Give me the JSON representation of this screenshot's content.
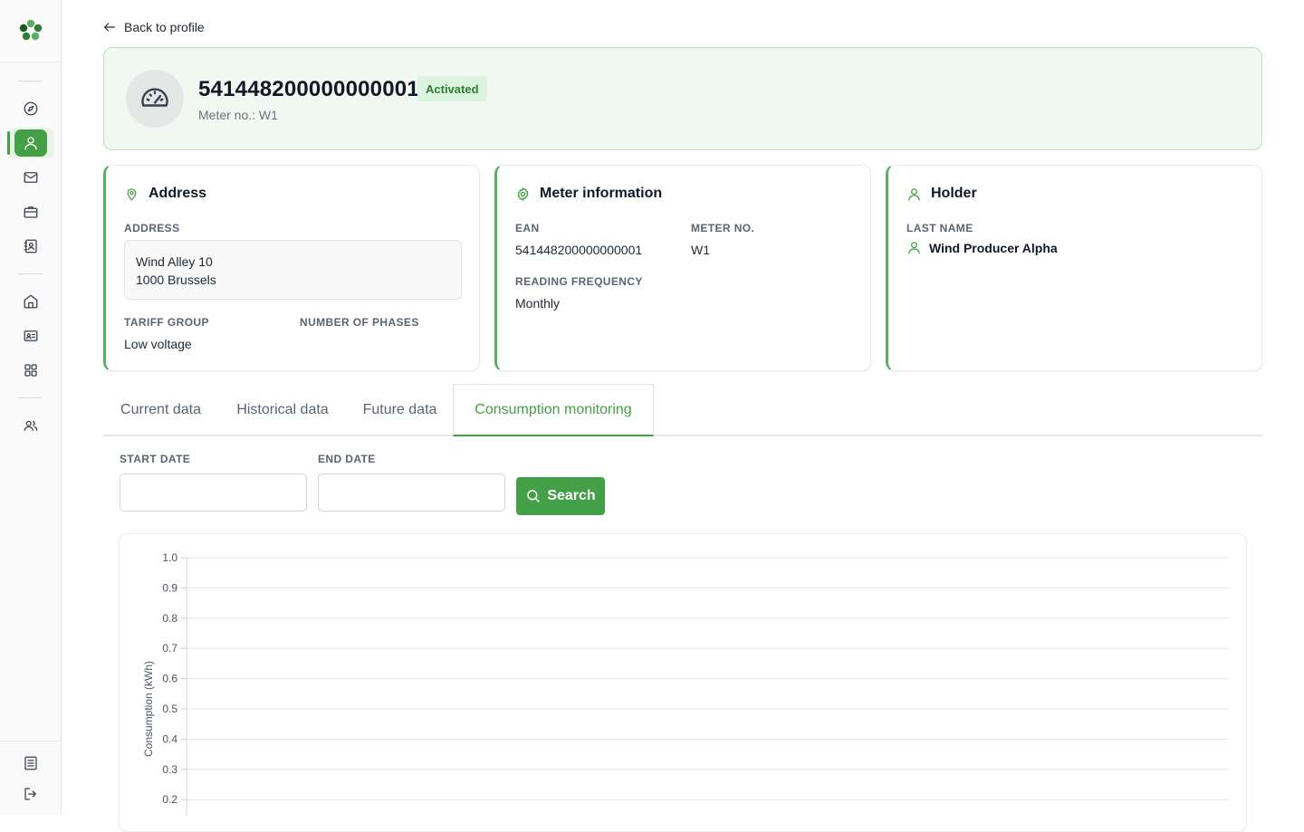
{
  "back_label": "Back to profile",
  "meter": {
    "ean": "541448200000000001",
    "status": "Activated",
    "subtitle": "Meter no.: W1"
  },
  "address_card": {
    "title": "Address",
    "address_label": "ADDRESS",
    "line1": "Wind Alley 10",
    "line2": "1000 Brussels",
    "tariff_label": "TARIFF GROUP",
    "tariff_value": "Low voltage",
    "phases_label": "NUMBER OF PHASES"
  },
  "meter_card": {
    "title": "Meter information",
    "ean_label": "EAN",
    "ean_value": "541448200000000001",
    "meter_no_label": "METER NO.",
    "meter_no_value": "W1",
    "freq_label": "READING FREQUENCY",
    "freq_value": "Monthly"
  },
  "holder_card": {
    "title": "Holder",
    "last_name_label": "LAST NAME",
    "last_name_value": "Wind Producer Alpha"
  },
  "tabs": [
    "Current data",
    "Historical data",
    "Future data",
    "Consumption monitoring"
  ],
  "active_tab": 3,
  "filters": {
    "start_label": "START DATE",
    "end_label": "END DATE",
    "start_value": "",
    "end_value": "",
    "search_label": "Search"
  },
  "colors": {
    "accent": "#43a047",
    "badge_bg": "#dcf3df",
    "hero_bg": "#f1f8f1"
  },
  "sidebar": {
    "icons": [
      "logo-icon",
      "compass-icon",
      "user-icon",
      "mail-icon",
      "briefcase-icon",
      "contact-card-icon",
      "home-icon",
      "id-card-icon",
      "grid-icon",
      "users-icon",
      "document-icon",
      "logout-icon"
    ],
    "active": "user-icon"
  },
  "chart_data": {
    "type": "line",
    "ylabel": "Consumption (kWh)",
    "ylim": [
      0.2,
      1.0
    ],
    "y_ticks": [
      "0.2",
      "0.3",
      "0.4",
      "0.5",
      "0.6",
      "0.7",
      "0.8",
      "0.9",
      "1.0"
    ],
    "grid": true,
    "series": []
  }
}
